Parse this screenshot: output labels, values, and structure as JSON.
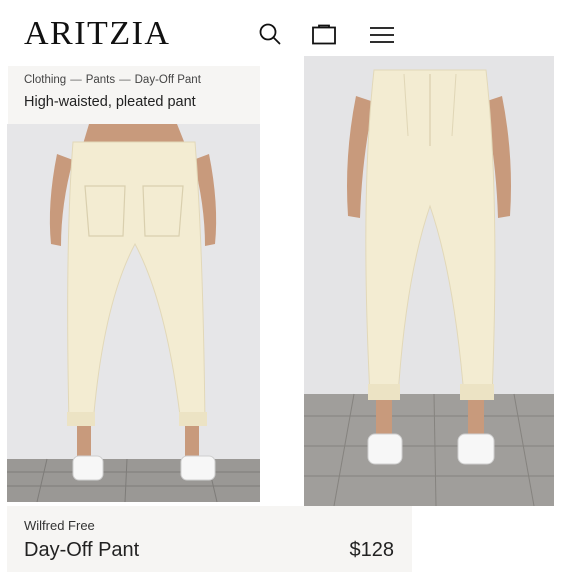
{
  "header": {
    "logo_text": "ARITZIA",
    "search_icon": "search-icon",
    "bag_icon": "shopping-bag-icon",
    "menu_icon": "hamburger-menu-icon"
  },
  "breadcrumb": {
    "items": [
      "Clothing",
      "Pants",
      "Day-Off Pant"
    ],
    "separator": "—"
  },
  "subtitle": "High-waisted, pleated pant",
  "product": {
    "brand": "Wilfred Free",
    "name": "Day-Off Pant",
    "price": "$128"
  },
  "colors": {
    "pant": "#f3ecd2",
    "wall": "#e6e6e8",
    "floor": "#9a9895",
    "panel": "#f6f5f3"
  }
}
